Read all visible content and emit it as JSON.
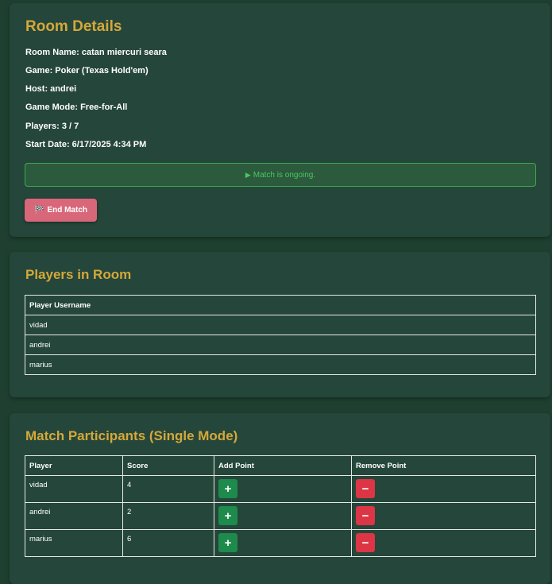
{
  "room_details": {
    "title": "Room Details",
    "room_name": "Room Name: catan miercuri seara",
    "game": "Game: Poker (Texas Hold'em)",
    "host": "Host: andrei",
    "game_mode": "Game Mode: Free-for-All",
    "players": "Players: 3 / 7",
    "start_date": "Start Date: 6/17/2025 4:34 PM",
    "status_icon": "play-icon",
    "status_text": "Match is ongoing.",
    "end_match_icon": "flag-icon",
    "end_match_label": "End Match"
  },
  "players_in_room": {
    "title": "Players in Room",
    "header": "Player Username",
    "players": [
      "vidad",
      "andrei",
      "marius"
    ]
  },
  "match_participants": {
    "title": "Match Participants (Single Mode)",
    "headers": {
      "player": "Player",
      "score": "Score",
      "add": "Add Point",
      "remove": "Remove Point"
    },
    "rows": [
      {
        "player": "vidad",
        "score": "4"
      },
      {
        "player": "andrei",
        "score": "2"
      },
      {
        "player": "marius",
        "score": "6"
      }
    ],
    "add_symbol": "+",
    "remove_symbol": "−"
  },
  "colors": {
    "background": "#1f4030",
    "card": "#25463a",
    "heading": "#d4a83a",
    "status_text": "#4cc760",
    "end_button": "#d9677a",
    "add_button": "#1e8a4c",
    "remove_button": "#dc3545"
  }
}
